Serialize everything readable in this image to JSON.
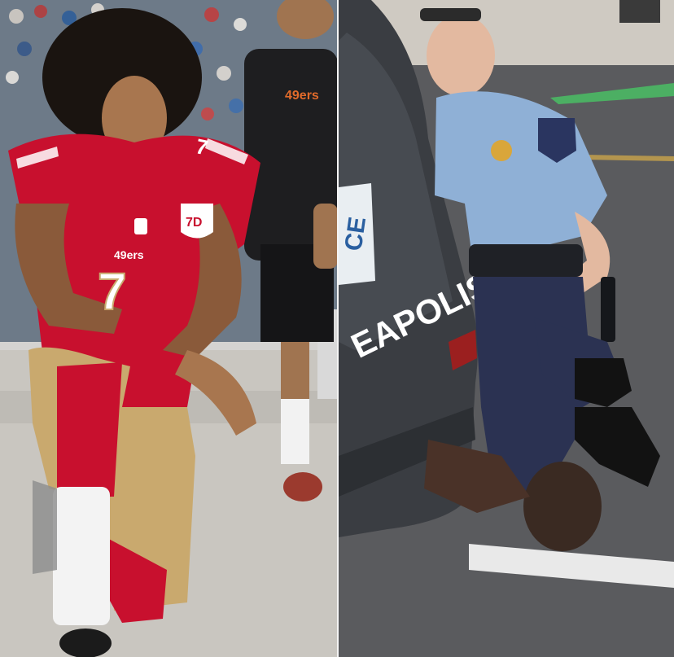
{
  "left_panel": {
    "jersey_number_front": "7",
    "jersey_number_sleeve": "7",
    "jersey_wordmark": "49ers",
    "bystander_shirt_wordmark": "49ers",
    "badge_text": "7D",
    "colors": {
      "jersey_red": "#c8102e",
      "pants_gold": "#c9a96e",
      "turf": "#c9c6c0"
    }
  },
  "right_panel": {
    "car_door_lettering": "EAPOLIS",
    "license_plate_text": "CE",
    "colors": {
      "uniform_blue": "#8fb0d6",
      "pavement": "#5a5b5e",
      "car_body": "#3a3d42"
    }
  }
}
